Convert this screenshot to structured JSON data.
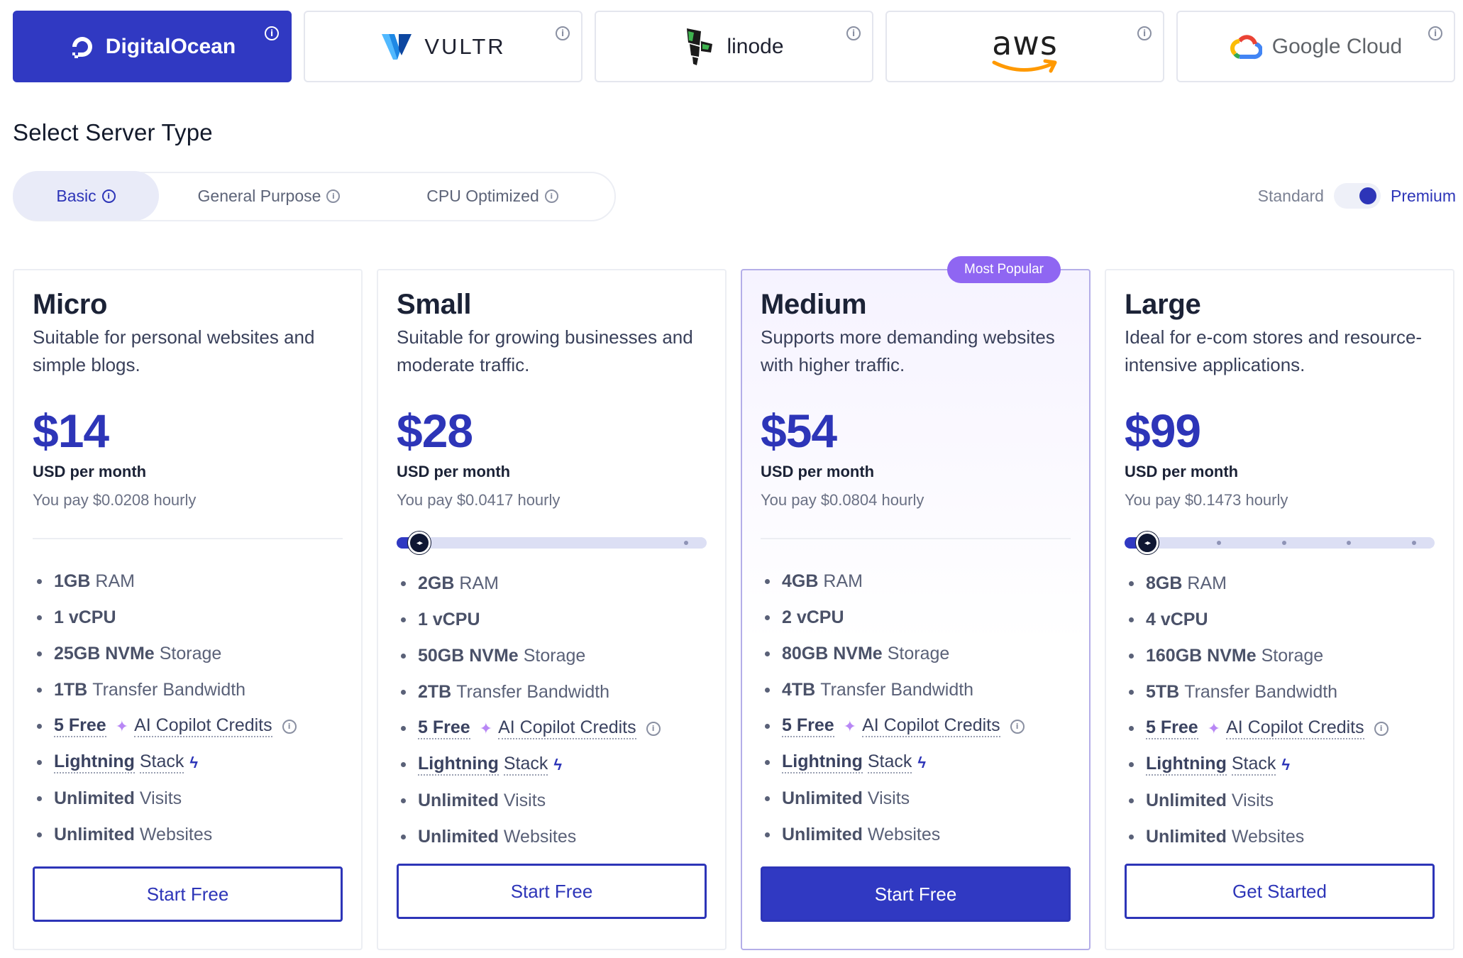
{
  "providers": [
    {
      "name": "DigitalOcean",
      "icon": "digitalocean-logo-icon",
      "active": true
    },
    {
      "name": "VULTR",
      "icon": "vultr-logo-icon",
      "active": false
    },
    {
      "name": "linode",
      "icon": "linode-logo-icon",
      "active": false
    },
    {
      "name": "aws",
      "icon": "aws-logo-icon",
      "active": false
    },
    {
      "name": "Google Cloud",
      "icon": "google-cloud-logo-icon",
      "active": false
    }
  ],
  "section_title": "Select Server Type",
  "server_types": [
    {
      "label": "Basic",
      "active": true
    },
    {
      "label": "General Purpose",
      "active": false
    },
    {
      "label": "CPU Optimized",
      "active": false
    }
  ],
  "plan_toggle": {
    "off_label": "Standard",
    "on_label": "Premium",
    "selected": "Premium"
  },
  "colors": {
    "accent": "#3039c2",
    "badge": "#8f66f2",
    "border": "#eceef3"
  },
  "plans": [
    {
      "name": "Micro",
      "description": "Suitable for personal websites and simple blogs.",
      "price": "$14",
      "unit": "USD per month",
      "hourly": "You pay $0.0208 hourly",
      "features": {
        "ram": {
          "value": "1GB",
          "label": "RAM"
        },
        "cpu": {
          "value": "1 vCPU",
          "label": ""
        },
        "storage": {
          "value": "25GB NVMe",
          "label": "Storage"
        },
        "bandwidth": {
          "value": "1TB",
          "label": "Transfer Bandwidth"
        },
        "credits": {
          "value": "5 Free",
          "label": "AI Copilot Credits"
        },
        "stack": {
          "value": "Lightning",
          "label": "Stack"
        },
        "visits": {
          "value": "Unlimited",
          "label": "Visits"
        },
        "websites": {
          "value": "Unlimited",
          "label": "Websites"
        }
      },
      "cta": "Start Free"
    },
    {
      "name": "Small",
      "description": "Suitable for growing businesses and moderate traffic.",
      "price": "$28",
      "unit": "USD per month",
      "hourly": "You pay $0.0417 hourly",
      "slider": {
        "position": 0,
        "stops": 2
      },
      "features": {
        "ram": {
          "value": "2GB",
          "label": "RAM"
        },
        "cpu": {
          "value": "1 vCPU",
          "label": ""
        },
        "storage": {
          "value": "50GB NVMe",
          "label": "Storage"
        },
        "bandwidth": {
          "value": "2TB",
          "label": "Transfer Bandwidth"
        },
        "credits": {
          "value": "5 Free",
          "label": "AI Copilot Credits"
        },
        "stack": {
          "value": "Lightning",
          "label": "Stack"
        },
        "visits": {
          "value": "Unlimited",
          "label": "Visits"
        },
        "websites": {
          "value": "Unlimited",
          "label": "Websites"
        }
      },
      "cta": "Start Free"
    },
    {
      "name": "Medium",
      "badge": "Most Popular",
      "description": "Supports more demanding websites with higher traffic.",
      "price": "$54",
      "unit": "USD per month",
      "hourly": "You pay $0.0804 hourly",
      "features": {
        "ram": {
          "value": "4GB",
          "label": "RAM"
        },
        "cpu": {
          "value": "2 vCPU",
          "label": ""
        },
        "storage": {
          "value": "80GB NVMe",
          "label": "Storage"
        },
        "bandwidth": {
          "value": "4TB",
          "label": "Transfer Bandwidth"
        },
        "credits": {
          "value": "5 Free",
          "label": "AI Copilot Credits"
        },
        "stack": {
          "value": "Lightning",
          "label": "Stack"
        },
        "visits": {
          "value": "Unlimited",
          "label": "Visits"
        },
        "websites": {
          "value": "Unlimited",
          "label": "Websites"
        }
      },
      "cta": "Start Free"
    },
    {
      "name": "Large",
      "description": "Ideal for e-com stores and resource-intensive applications.",
      "price": "$99",
      "unit": "USD per month",
      "hourly": "You pay $0.1473 hourly",
      "slider": {
        "position": 0,
        "stops": 5
      },
      "features": {
        "ram": {
          "value": "8GB",
          "label": "RAM"
        },
        "cpu": {
          "value": "4 vCPU",
          "label": ""
        },
        "storage": {
          "value": "160GB NVMe",
          "label": "Storage"
        },
        "bandwidth": {
          "value": "5TB",
          "label": "Transfer Bandwidth"
        },
        "credits": {
          "value": "5 Free",
          "label": "AI Copilot Credits"
        },
        "stack": {
          "value": "Lightning",
          "label": "Stack"
        },
        "visits": {
          "value": "Unlimited",
          "label": "Visits"
        },
        "websites": {
          "value": "Unlimited",
          "label": "Websites"
        }
      },
      "cta": "Get Started"
    }
  ]
}
